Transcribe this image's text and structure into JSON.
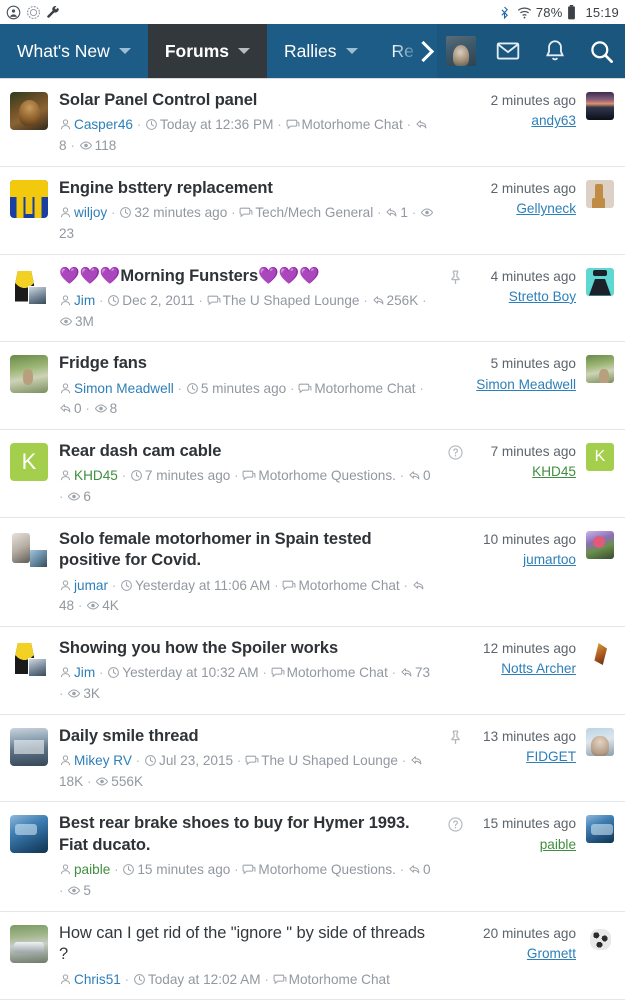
{
  "statusbar": {
    "left_icons": [
      "account-circle-icon",
      "circle-dashed-icon",
      "wrench-icon"
    ],
    "bluetooth_icon": "bluetooth-icon",
    "wifi_icon": "wifi-icon",
    "battery_percent": "78%",
    "battery_icon": "battery-icon",
    "time": "15:19"
  },
  "navbar": {
    "items": [
      {
        "label": "What's New",
        "has_caret": true,
        "active": false
      },
      {
        "label": "Forums",
        "has_caret": true,
        "active": true
      },
      {
        "label": "Rallies",
        "has_caret": true,
        "active": false
      },
      {
        "label": "Re",
        "has_caret": false,
        "active": false
      }
    ],
    "overflow_icon": "chevron-right-icon",
    "avatar_icon": "user-avatar",
    "inbox_icon": "envelope-icon",
    "alerts_icon": "bell-icon",
    "search_icon": "search-icon"
  },
  "threads": [
    {
      "title": "Solar Panel Control panel",
      "bold": true,
      "avatar": "a-dog",
      "avatar_letter": "",
      "author": "Casper46",
      "author_color": "blue",
      "date": "Today at 12:36 PM",
      "forum": "Motorhome Chat",
      "replies": "8",
      "views": "118",
      "badge": "",
      "last_time": "2 minutes ago",
      "last_user": "andy63",
      "last_user_color": "blue",
      "last_avatar": "a-sunset",
      "last_avatar_letter": ""
    },
    {
      "title": "Engine bsttery replacement",
      "bold": true,
      "avatar": "a-flag",
      "avatar_letter": "",
      "author": "wiljoy",
      "author_color": "blue",
      "date": "32 minutes ago",
      "forum": "Tech/Mech General",
      "replies": "1",
      "views": "23",
      "badge": "",
      "last_time": "2 minutes ago",
      "last_user": "Gellyneck",
      "last_user_color": "blue",
      "last_avatar": "a-giraffe",
      "last_avatar_letter": ""
    },
    {
      "title": "💜💜💜Morning Funsters💜💜💜",
      "bold": true,
      "avatar": "a-jim",
      "avatar_letter": "",
      "author": "Jim",
      "author_color": "blue",
      "date": "Dec 2, 2011",
      "forum": "The U Shaped Lounge",
      "replies": "256K",
      "views": "3M",
      "badge": "pin",
      "last_time": "4 minutes ago",
      "last_user": "Stretto Boy",
      "last_user_color": "blue",
      "last_avatar": "a-suit",
      "last_avatar_letter": ""
    },
    {
      "title": "Fridge fans",
      "bold": true,
      "avatar": "a-path",
      "avatar_letter": "",
      "author": "Simon Meadwell",
      "author_color": "blue",
      "date": "5 minutes ago",
      "forum": "Motorhome Chat",
      "replies": "0",
      "views": "8",
      "badge": "",
      "last_time": "5 minutes ago",
      "last_user": "Simon Meadwell",
      "last_user_color": "blue",
      "last_avatar": "a-path",
      "last_avatar_letter": ""
    },
    {
      "title": "Rear dash cam cable",
      "bold": true,
      "avatar": "a-k",
      "avatar_letter": "K",
      "author": "KHD45",
      "author_color": "green",
      "date": "7 minutes ago",
      "forum": "Motorhome Questions.",
      "replies": "0",
      "views": "6",
      "badge": "question",
      "last_time": "7 minutes ago",
      "last_user": "KHD45",
      "last_user_color": "green",
      "last_avatar": "a-k",
      "last_avatar_letter": "K"
    },
    {
      "title": "Solo female motorhomer in Spain tested positive for Covid.",
      "bold": true,
      "avatar": "a-solo",
      "avatar_letter": "",
      "author": "jumar",
      "author_color": "blue",
      "date": "Yesterday at 11:06 AM",
      "forum": "Motorhome Chat",
      "replies": "48",
      "views": "4K",
      "badge": "",
      "last_time": "10 minutes ago",
      "last_user": "jumartoo",
      "last_user_color": "blue",
      "last_avatar": "a-flower",
      "last_avatar_letter": ""
    },
    {
      "title": "Showing you how the Spoiler works",
      "bold": true,
      "avatar": "a-jim",
      "avatar_letter": "",
      "author": "Jim",
      "author_color": "blue",
      "date": "Yesterday at 10:32 AM",
      "forum": "Motorhome Chat",
      "replies": "73",
      "views": "3K",
      "badge": "",
      "last_time": "12 minutes ago",
      "last_user": "Notts Archer",
      "last_user_color": "blue",
      "last_avatar": "a-archer",
      "last_avatar_letter": ""
    },
    {
      "title": "Daily smile thread",
      "bold": true,
      "avatar": "a-bus",
      "avatar_letter": "",
      "author": "Mikey RV",
      "author_color": "blue",
      "date": "Jul 23, 2015",
      "forum": "The U Shaped Lounge",
      "replies": "18K",
      "views": "556K",
      "badge": "pin",
      "last_time": "13 minutes ago",
      "last_user": "FIDGET",
      "last_user_color": "blue",
      "last_avatar": "a-fidget",
      "last_avatar_letter": ""
    },
    {
      "title": "Best rear brake shoes to buy for Hymer 1993. Fiat ducato.",
      "bold": true,
      "avatar": "a-blue",
      "avatar_letter": "",
      "author": "paible",
      "author_color": "green",
      "date": "15 minutes ago",
      "forum": "Motorhome Questions.",
      "replies": "0",
      "views": "5",
      "badge": "question",
      "last_time": "15 minutes ago",
      "last_user": "paible",
      "last_user_color": "green",
      "last_avatar": "a-blue",
      "last_avatar_letter": ""
    },
    {
      "title": "How can I get rid of the \"ignore \" by side of threads ?",
      "bold": false,
      "avatar": "a-car",
      "avatar_letter": "",
      "author": "Chris51",
      "author_color": "blue",
      "date": "Today at 12:02 AM",
      "forum": "Motorhome Chat",
      "replies": "",
      "views": "",
      "badge": "",
      "last_time": "20 minutes ago",
      "last_user": "Gromett",
      "last_user_color": "blue",
      "last_avatar": "a-dalm",
      "last_avatar_letter": ""
    }
  ],
  "icons": {
    "user": "user-icon",
    "clock": "clock-icon",
    "forum": "comments-icon",
    "reply": "reply-icon",
    "eye": "eye-icon",
    "pin": "pin-icon",
    "question": "question-circle-icon",
    "separator": "·"
  },
  "colors": {
    "navbar": "#1d5c87",
    "nav_active": "#33383d",
    "link": "#2c7fb8",
    "link_green": "#3f8f3f",
    "title": "#2f3337",
    "meta": "#9298a0",
    "page_bg": "#e9eaec"
  }
}
